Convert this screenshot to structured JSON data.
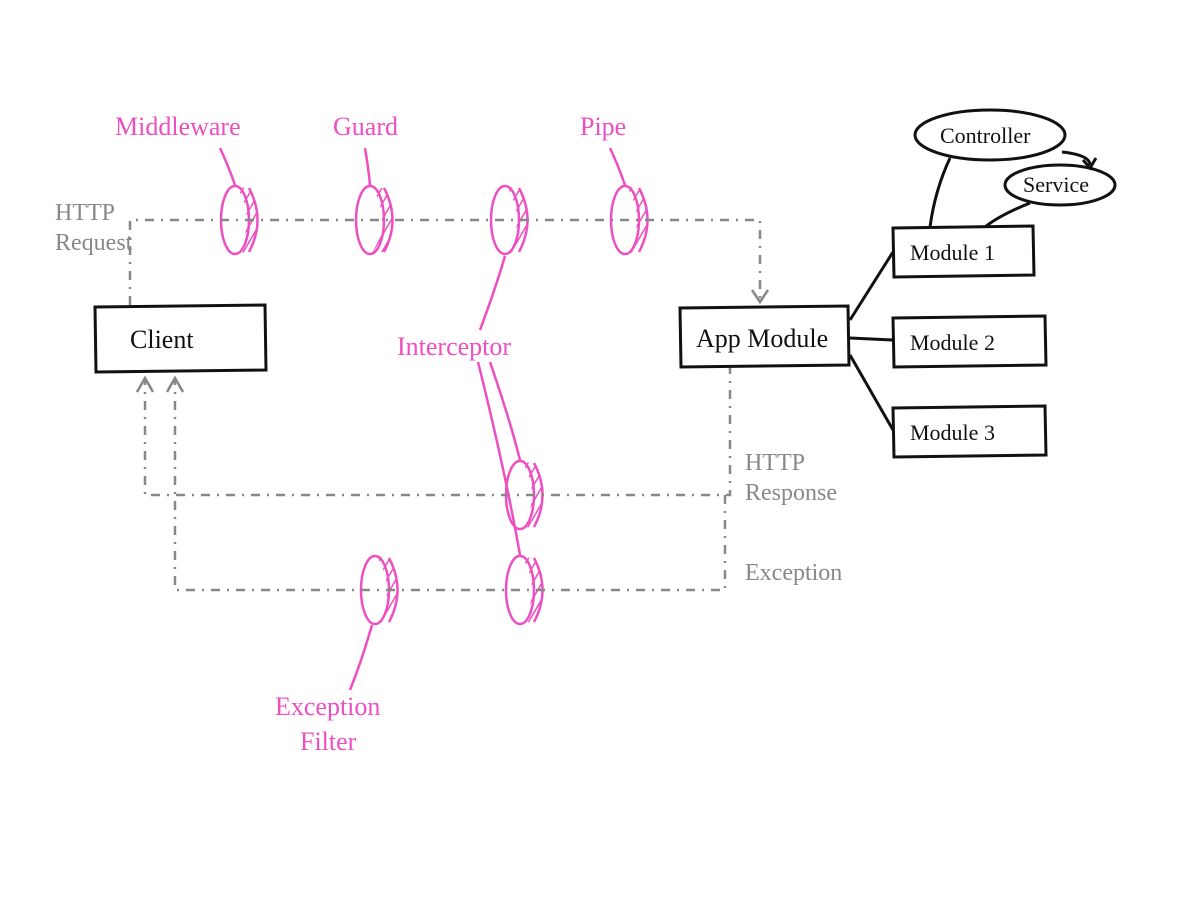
{
  "labels": {
    "middleware": "Middleware",
    "guard": "Guard",
    "pipe": "Pipe",
    "interceptor": "Interceptor",
    "exception_filter_1": "Exception",
    "exception_filter_2": "Filter",
    "http_request_1": "HTTP",
    "http_request_2": "Request",
    "http_response_1": "HTTP",
    "http_response_2": "Response",
    "exception": "Exception"
  },
  "boxes": {
    "client": "Client",
    "app_module": "App Module",
    "module1": "Module 1",
    "module2": "Module 2",
    "module3": "Module 3",
    "controller": "Controller",
    "service": "Service"
  },
  "colors": {
    "pink": "#ed4fc1",
    "gray": "#888888",
    "black": "#111111"
  }
}
